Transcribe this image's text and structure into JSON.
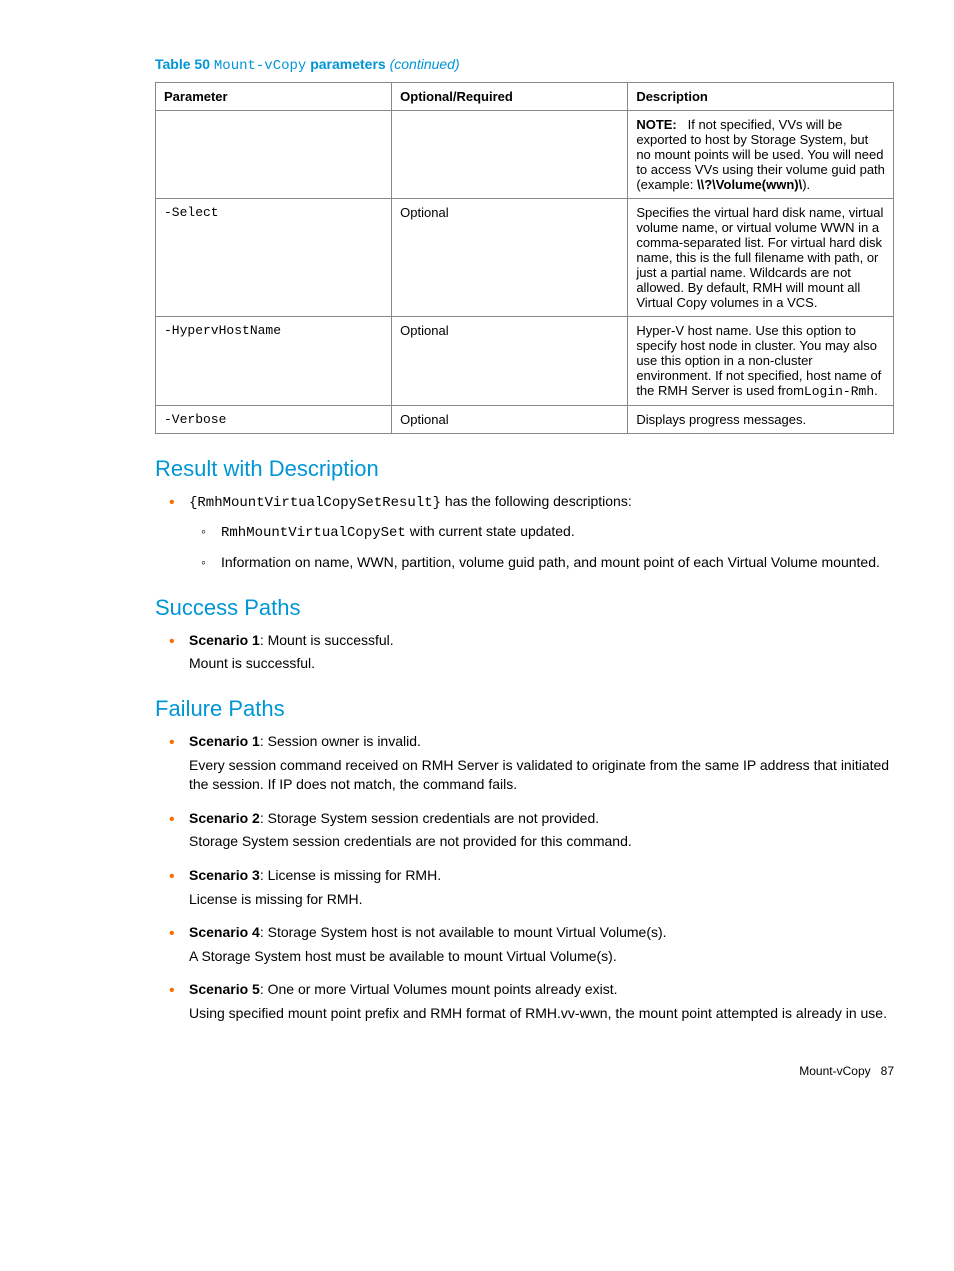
{
  "caption": {
    "table_num": "Table 50",
    "command": "Mount-vCopy",
    "word_parameters": "parameters",
    "continued": "(continued)"
  },
  "table": {
    "headers": [
      "Parameter",
      "Optional/Required",
      "Description"
    ],
    "rows": [
      {
        "parameter": "",
        "optreq": "",
        "note_label": "NOTE:",
        "note_text": "If not specified, VVs will be exported to host by Storage System, but no mount points will be used. You will need to access VVs using their volume guid path (example:",
        "note_mono": "\\\\?\\Volume(wwn)\\",
        "note_close": ")."
      },
      {
        "parameter": "-Select",
        "optreq": "Optional",
        "desc": "Specifies the virtual hard disk name, virtual volume name, or virtual volume WWN in a comma-separated list. For virtual hard disk name, this is the full filename with path, or just a partial name. Wildcards are not allowed. By default, RMH will mount all Virtual Copy volumes in a VCS."
      },
      {
        "parameter": "-HypervHostName",
        "optreq": "Optional",
        "desc_pre": "Hyper-V host name. Use this option to specify host node in cluster. You may also use this option in a non-cluster environment. If not specified, host name of the RMH Server is used from",
        "desc_mono": "Login-Rmh",
        "desc_post": "."
      },
      {
        "parameter": "-Verbose",
        "optreq": "Optional",
        "desc": "Displays progress messages."
      }
    ]
  },
  "sections": {
    "result_title": "Result with Description",
    "result_intro_mono": "{RmhMountVirtualCopySetResult}",
    "result_intro_rest": " has the following descriptions:",
    "result_sub1_mono": "RmhMountVirtualCopySet",
    "result_sub1_rest": " with current state updated.",
    "result_sub2": "Information on name, WWN, partition, volume guid path, and mount point of each Virtual Volume mounted.",
    "success_title": "Success Paths",
    "success": [
      {
        "label": "Scenario 1",
        "head": ": Mount is successful.",
        "body": "Mount is successful."
      }
    ],
    "failure_title": "Failure Paths",
    "failure": [
      {
        "label": "Scenario 1",
        "head": ": Session owner is invalid.",
        "body": "Every session command received on RMH Server is validated to originate from the same IP address that initiated the session. If IP does not match, the command fails."
      },
      {
        "label": "Scenario 2",
        "head": ": Storage System session credentials are not provided.",
        "body": "Storage System session credentials are not provided for this command."
      },
      {
        "label": "Scenario 3",
        "head": ": License is missing for RMH.",
        "body": "License is missing for RMH."
      },
      {
        "label": "Scenario 4",
        "head": ": Storage System host is not available to mount Virtual Volume(s).",
        "body": "A Storage System host must be available to mount Virtual Volume(s)."
      },
      {
        "label": "Scenario 5",
        "head": ": One or more Virtual Volumes mount points already exist.",
        "body": "Using specified mount point prefix and RMH format of RMH.vv-wwn, the mount point attempted is already in use."
      }
    ]
  },
  "footer": {
    "section": "Mount-vCopy",
    "page": "87"
  }
}
